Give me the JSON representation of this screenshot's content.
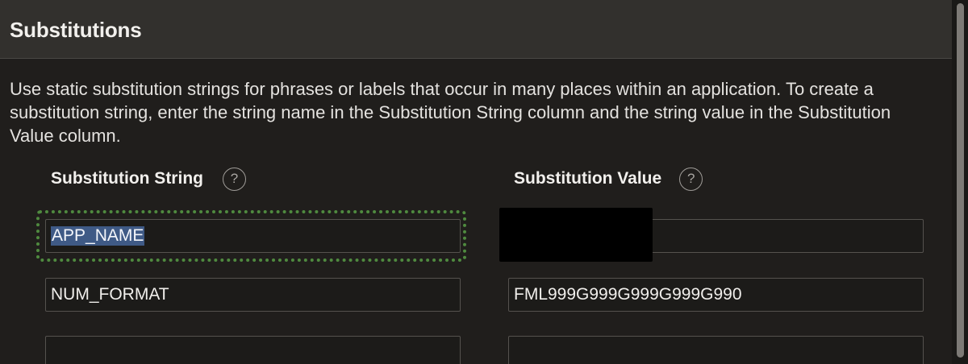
{
  "header": {
    "title": "Substitutions"
  },
  "description": "Use static substitution strings for phrases or labels that occur in many places within an application. To create a substitution string, enter the string name in the Substitution String column and the string value in the Substitution Value column.",
  "columns": {
    "string_label": "Substitution String",
    "value_label": "Substitution Value",
    "help_glyph": "?"
  },
  "rows": [
    {
      "string": "APP_NAME",
      "value": ""
    },
    {
      "string": "NUM_FORMAT",
      "value": "FML999G999G999G999G990"
    },
    {
      "string": "",
      "value": ""
    }
  ],
  "colors": {
    "background": "#201e1c",
    "header": "#32302d",
    "focus": "#4f8a3f",
    "selection": "#3f5a86"
  }
}
